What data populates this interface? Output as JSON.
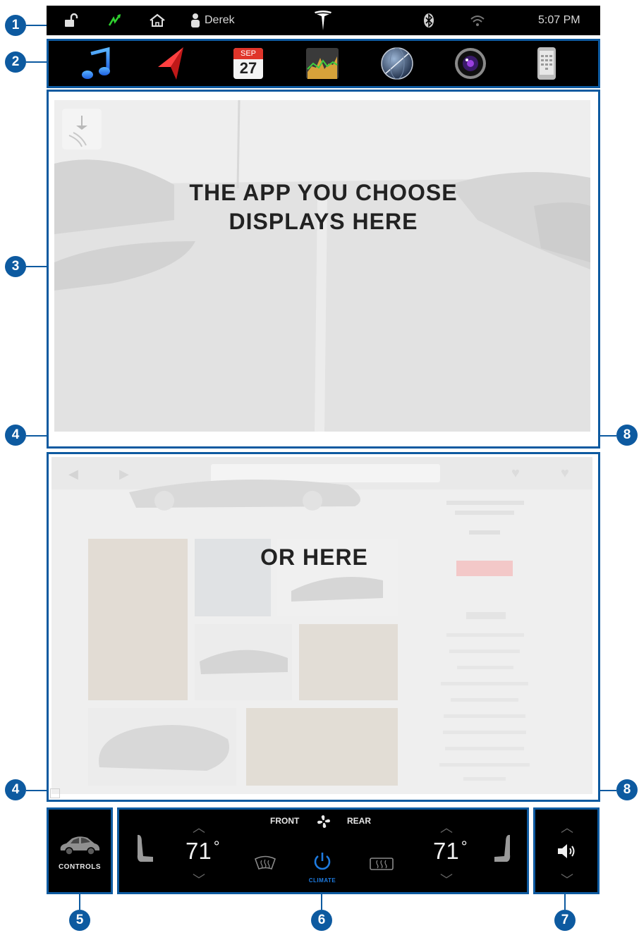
{
  "status_bar": {
    "user_name": "Derek",
    "time": "5:07 PM",
    "icons": [
      "unlock-icon",
      "charging-icon",
      "homelink-icon",
      "driver-profile-icon",
      "tesla-logo",
      "bluetooth-icon",
      "wifi-icon"
    ]
  },
  "app_bar": {
    "apps": [
      "media-player",
      "navigation",
      "calendar",
      "energy",
      "web-browser",
      "camera",
      "phone"
    ],
    "calendar_month": "SEP",
    "calendar_day": "27"
  },
  "upper_panel": {
    "line1": "THE APP YOU CHOOSE",
    "line2": "DISPLAYS HERE"
  },
  "lower_panel": {
    "text": "OR HERE"
  },
  "controls": {
    "label": "CONTROLS"
  },
  "climate": {
    "front_label": "FRONT",
    "rear_label": "REAR",
    "driver_temp": "71",
    "passenger_temp": "71",
    "degree": "°",
    "power_label": "CLIMATE"
  },
  "callouts": {
    "c1": "1",
    "c2": "2",
    "c3": "3",
    "c4a": "4",
    "c4b": "4",
    "c5": "5",
    "c6": "6",
    "c7": "7",
    "c8a": "8",
    "c8b": "8"
  },
  "colors": {
    "callout_blue": "#0d5aa0",
    "charging_green": "#2fd12f",
    "climate_blue": "#1e7be0"
  }
}
